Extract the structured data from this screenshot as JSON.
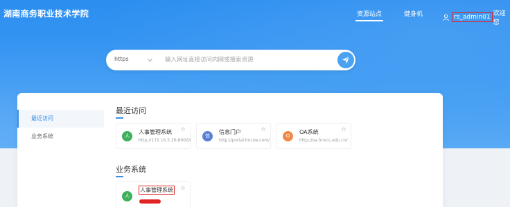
{
  "header": {
    "site_title": "湖南商务职业技术学院",
    "nav": [
      {
        "label": "资源站点"
      },
      {
        "label": "健身机"
      }
    ],
    "username": "rs_admin01",
    "welcome": "欢迎您"
  },
  "search": {
    "select_value": "https",
    "placeholder": "输入网址直接访问内网或搜索资源"
  },
  "sidebar": {
    "items": [
      {
        "label": "最近访问"
      },
      {
        "label": "业务系统"
      }
    ]
  },
  "recent": {
    "title": "最近访问",
    "cards": [
      {
        "avatar": "人",
        "name": "人事管理系统",
        "url": "http://172.16.5.26:8000/c",
        "color": "#3eaf5c"
      },
      {
        "avatar": "信",
        "name": "信息门户",
        "url": "http://portal.hncsw.com/",
        "color": "#5a7fd6"
      },
      {
        "avatar": "O",
        "name": "OA系统",
        "url": "http://oa.hnvcc.edu.cn/",
        "color": "#f08a4b"
      }
    ]
  },
  "business": {
    "title": "业务系统",
    "cards": [
      {
        "avatar": "人",
        "name": "人事管理系统",
        "color": "#3eaf5c"
      }
    ]
  }
}
